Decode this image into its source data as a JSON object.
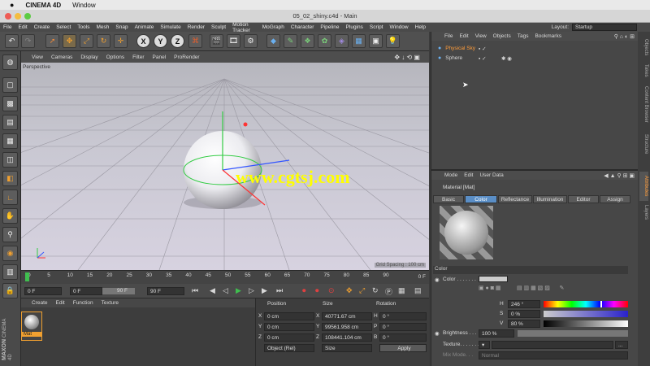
{
  "mac_menu": {
    "app": "CINEMA 4D",
    "window": "Window"
  },
  "window_title": "05_02_shiny.c4d - Main",
  "main_menu": [
    "File",
    "Edit",
    "Create",
    "Select",
    "Tools",
    "Mesh",
    "Snap",
    "Animate",
    "Simulate",
    "Render",
    "Sculpt",
    "Motion Tracker",
    "MoGraph",
    "Character",
    "Pipeline",
    "Plugins",
    "Script",
    "Window",
    "Help"
  ],
  "layout": {
    "label": "Layout:",
    "value": "Startup"
  },
  "toolbar": {
    "x_label": "X",
    "y_label": "Y",
    "z_label": "Z"
  },
  "viewport_menu": [
    "View",
    "Cameras",
    "Display",
    "Options",
    "Filter",
    "Panel",
    "ProRender"
  ],
  "viewport": {
    "camera": "Perspective",
    "grid_info": "Grid Spacing : 100 cm"
  },
  "watermark": "www.cgtsj.com",
  "timeline": {
    "ticks": [
      "0",
      "5",
      "10",
      "15",
      "20",
      "25",
      "30",
      "35",
      "40",
      "45",
      "50",
      "55",
      "60",
      "65",
      "70",
      "75",
      "80",
      "85",
      "90"
    ],
    "end_label": "0 F"
  },
  "transport": {
    "current": "0 F",
    "start": "0 F",
    "end": "90 F",
    "end2": "90 F"
  },
  "material_manager": {
    "menu": [
      "Create",
      "Edit",
      "Function",
      "Texture"
    ],
    "material_name": "Mat"
  },
  "coordinates": {
    "headers": [
      "Position",
      "Size",
      "Rotation"
    ],
    "rows": [
      {
        "axis": "X",
        "pos": "0 cm",
        "size": "40771.67 cm",
        "rot_axis": "H",
        "rot": "0 °"
      },
      {
        "axis": "Y",
        "pos": "0 cm",
        "size": "99561.958 cm",
        "rot_axis": "P",
        "rot": "0 °"
      },
      {
        "axis": "Z",
        "pos": "0 cm",
        "size": "108441.104 cm",
        "rot_axis": "B",
        "rot": "0 °"
      }
    ],
    "mode": "Object (Rel)",
    "size_mode": "Size",
    "apply": "Apply"
  },
  "objects_panel": {
    "menu": [
      "File",
      "Edit",
      "View",
      "Objects",
      "Tags",
      "Bookmarks"
    ],
    "items": [
      {
        "name": "Physical Sky",
        "selected": true
      },
      {
        "name": "Sphere",
        "selected": false
      }
    ]
  },
  "attributes_panel": {
    "menu": [
      "Mode",
      "Edit",
      "User Data"
    ],
    "title": "Material [Mat]",
    "tabs": [
      "Basic",
      "Color",
      "Reflectance",
      "Illumination",
      "Editor",
      "Assign"
    ],
    "active_tab": "Color",
    "section": "Color",
    "color_label": "Color . . . . . . .",
    "hsv": [
      {
        "label": "H",
        "value": "246 °"
      },
      {
        "label": "S",
        "value": "0 %"
      },
      {
        "label": "V",
        "value": "80 %"
      }
    ],
    "brightness_label": "Brightness . . .",
    "brightness_value": "100 %",
    "texture_label": "Texture. . . . . . .",
    "mix_mode_label": "Mix Mode. . .",
    "mix_mode_value": "Normal"
  },
  "right_tabs": [
    "Objects",
    "Takes",
    "Content Browser",
    "Structure",
    "Attributes",
    "Layers"
  ],
  "brand": {
    "maxon": "MAXON",
    "product": "CINEMA 4D"
  },
  "colors": {
    "accent_blue": "#5a8ec6",
    "selection_orange": "#ff9c3a",
    "watermark_yellow": "#ffff00"
  }
}
